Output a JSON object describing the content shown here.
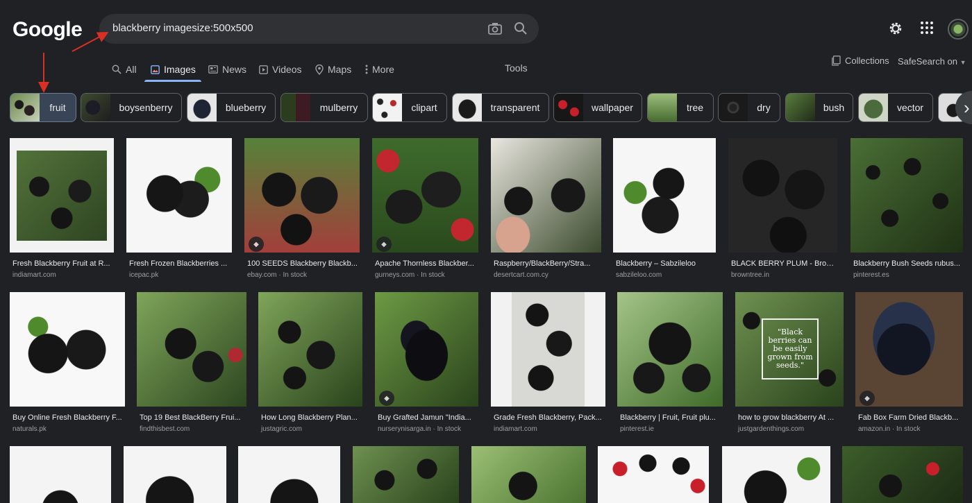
{
  "header": {
    "logo": "Google",
    "query": "blackberry imagesize:500x500"
  },
  "nav": {
    "tabs": [
      "All",
      "Images",
      "News",
      "Videos",
      "Maps",
      "More"
    ],
    "tools": "Tools",
    "collections": "Collections",
    "safesearch": "SafeSearch on"
  },
  "chips": [
    "fruit",
    "boysenberry",
    "blueberry",
    "mulberry",
    "clipart",
    "transparent",
    "wallpaper",
    "tree",
    "dry",
    "bush",
    "vector"
  ],
  "results": {
    "row1": [
      {
        "title": "Fresh Blackberry Fruit at R...",
        "source": "indiamart.com"
      },
      {
        "title": "Fresh Frozen Blackberries ...",
        "source": "icepac.pk"
      },
      {
        "title": "100 SEEDS Blackberry Blackb...",
        "source": "ebay.com · In stock"
      },
      {
        "title": "Apache Thornless Blackber...",
        "source": "gurneys.com · In stock"
      },
      {
        "title": "Raspberry/BlackBerry/Stra...",
        "source": "desertcart.com.cy"
      },
      {
        "title": "Blackberry – Sabzileloo",
        "source": "sabzileloo.com"
      },
      {
        "title": "BLACK BERRY PLUM - Brow...",
        "source": "browntree.in"
      },
      {
        "title": "Blackberry Bush Seeds rubus...",
        "source": "pinterest.es"
      }
    ],
    "row2": [
      {
        "title": "Buy Online Fresh Blackberry F...",
        "source": "naturals.pk"
      },
      {
        "title": "Top 19 Best BlackBerry Frui...",
        "source": "findthisbest.com"
      },
      {
        "title": "How Long Blackberry Plan...",
        "source": "justagric.com"
      },
      {
        "title": "Buy Grafted Jamun \"India...",
        "source": "nurserynisarga.in · In stock"
      },
      {
        "title": "Grade Fresh Blackberry, Pack...",
        "source": "indiamart.com"
      },
      {
        "title": "Blackberry | Fruit, Fruit plu...",
        "source": "pinterest.ie"
      },
      {
        "title": "how to grow blackberry At ...",
        "source": "justgardenthings.com"
      },
      {
        "title": "Fab Box Farm Dried Blackb...",
        "source": "amazon.in · In stock"
      }
    ],
    "overlay_text": "\"Black berries can be easily grown from seeds.\""
  }
}
